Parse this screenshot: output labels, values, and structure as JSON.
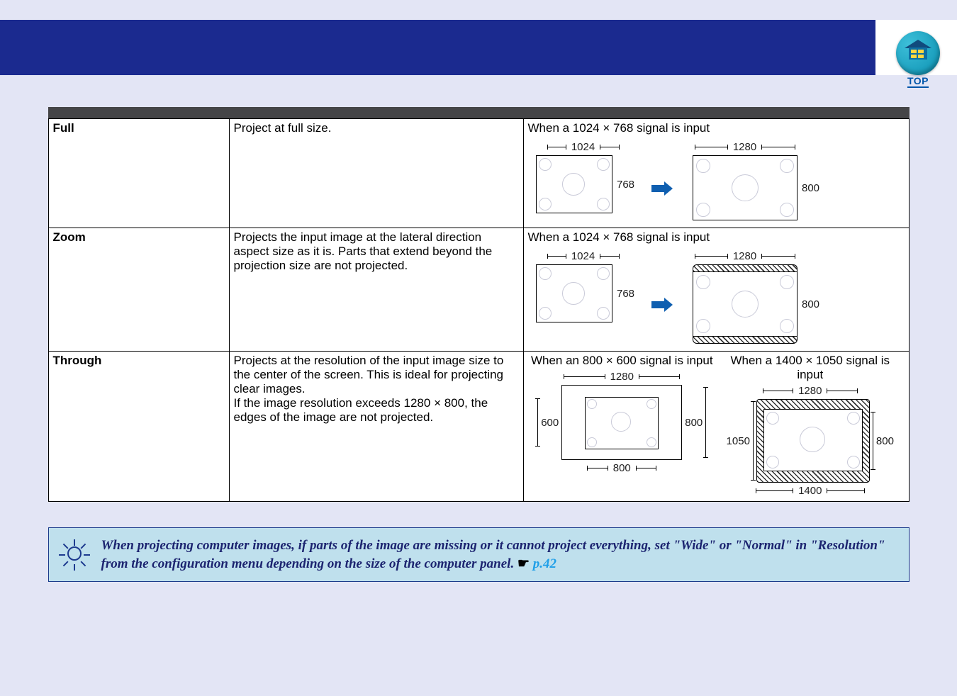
{
  "top_icon": {
    "label": "TOP"
  },
  "table": {
    "rows": [
      {
        "name": "Full",
        "desc": "Project at full size.",
        "right_heading": "When a 1024 × 768 signal is input",
        "left_dim_w": "1024",
        "left_dim_h": "768",
        "right_dim_w": "1280",
        "right_dim_h": "800"
      },
      {
        "name": "Zoom",
        "desc": "Projects the input image at the lateral direction aspect size as it is. Parts that extend beyond the projection size are not projected.",
        "right_heading": "When a 1024 × 768 signal is input",
        "left_dim_w": "1024",
        "left_dim_h": "768",
        "right_dim_w": "1280",
        "right_dim_h": "800"
      },
      {
        "name": "Through",
        "desc": "Projects at the resolution of the input image size to the center of the screen. This is ideal for projecting clear images.\nIf the image resolution exceeds 1280 × 800, the edges of the image are not projected.",
        "col_a_heading": "When an 800 × 600 signal is input",
        "col_b_heading": "When a 1400 × 1050 signal is input",
        "a_outer_w": "1280",
        "a_outer_h_left": "600",
        "a_outer_h_right": "800",
        "a_inner_w": "800",
        "b_outer_h_left": "1050",
        "b_outer_h_right": "800",
        "b_outer_w": "1280",
        "b_bottom_w": "1400"
      }
    ]
  },
  "tip": {
    "text_a": "When projecting computer images, if parts of the image are missing or it cannot project everything, set \"Wide\" or \"Normal\" in \"Resolution\" from the configuration menu depending on the size of the computer panel.",
    "hand": "☛",
    "link": "p.42"
  }
}
